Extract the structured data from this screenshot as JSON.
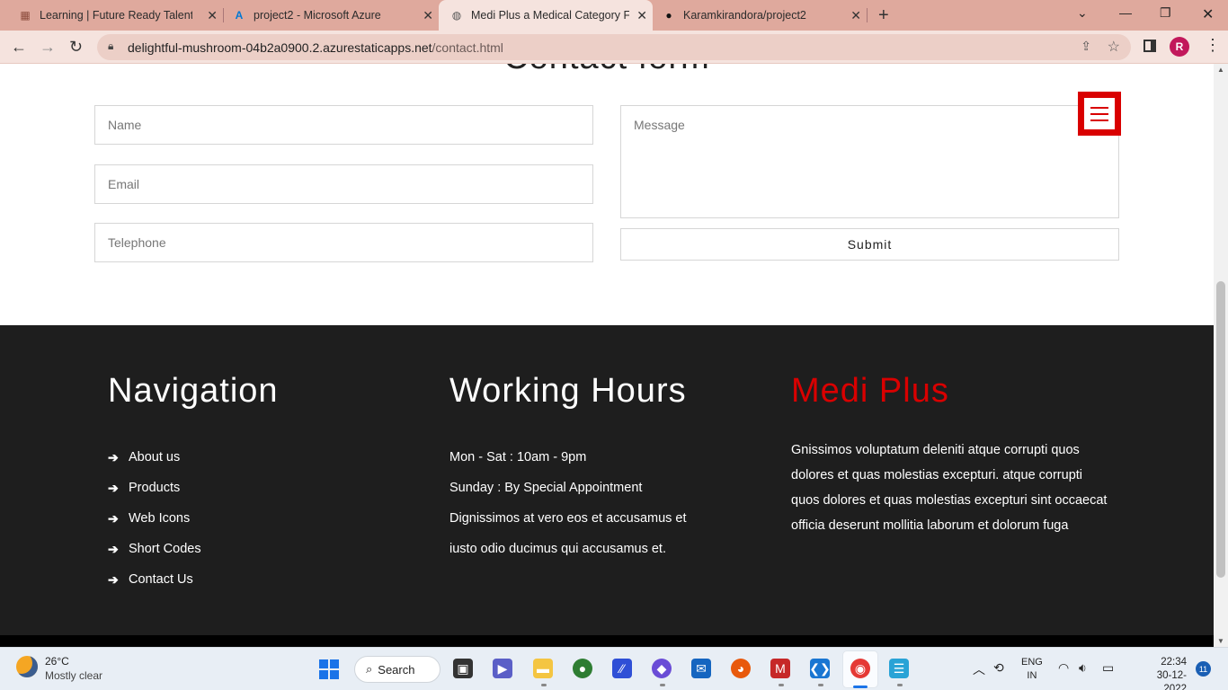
{
  "browser": {
    "tabs": [
      {
        "title": "Learning | Future Ready Talent",
        "icon": "learning-favicon"
      },
      {
        "title": "project2 - Microsoft Azure",
        "icon": "azure-favicon"
      },
      {
        "title": "Medi Plus a Medical Category Fla",
        "icon": "globe-favicon"
      },
      {
        "title": "Karamkirandora/project2",
        "icon": "github-favicon"
      }
    ],
    "url_host": "delightful-mushroom-04b2a0900.2.azurestaticapps.net",
    "url_path": "/contact.html",
    "profile_initial": "R"
  },
  "contact": {
    "title": "Contact form",
    "name_placeholder": "Name",
    "email_placeholder": "Email",
    "telephone_placeholder": "Telephone",
    "message_placeholder": "Message",
    "submit_label": "Submit"
  },
  "footer": {
    "navigation": {
      "heading": "Navigation",
      "items": [
        "About us",
        "Products",
        "Web Icons",
        "Short Codes",
        "Contact Us"
      ]
    },
    "hours": {
      "heading": "Working Hours",
      "lines": [
        "Mon - Sat : 10am - 9pm",
        "Sunday : By Special Appointment",
        "Dignissimos at vero eos et accusamus et",
        "iusto odio ducimus qui accusamus et."
      ]
    },
    "brand": {
      "heading": "Medi Plus",
      "text": "Gnissimos voluptatum deleniti atque corrupti quos dolores et quas molestias excepturi. atque corrupti quos dolores et quas molestias excepturi sint occaecat officia deserunt mollitia laborum et dolorum fuga"
    }
  },
  "taskbar": {
    "weather_temp": "26°C",
    "weather_desc": "Mostly clear",
    "search_label": "Search",
    "lang_top": "ENG",
    "lang_bottom": "IN",
    "time": "22:34",
    "date": "30-12-2022",
    "notification_count": "11"
  },
  "colors": {
    "accent_red": "#d90000",
    "footer_bg": "#1e1e1e",
    "tab_bar": "#dfa99d"
  }
}
